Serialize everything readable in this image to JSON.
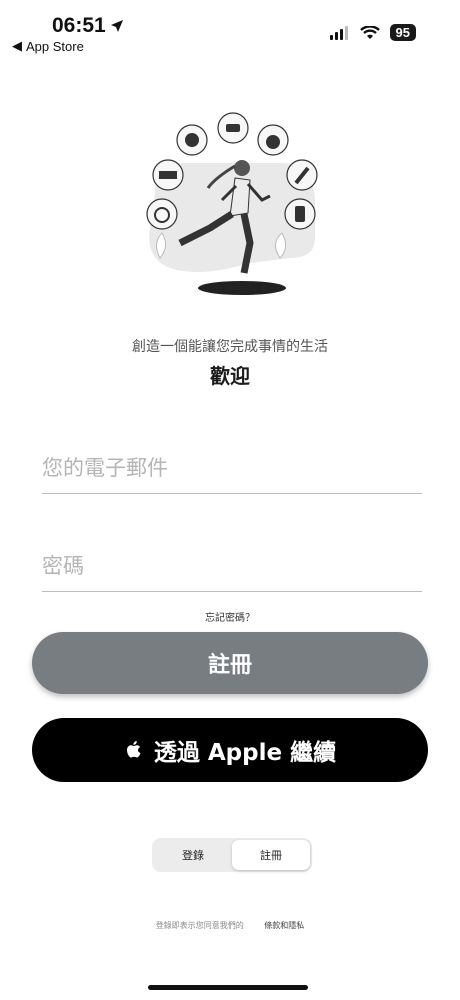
{
  "status_bar": {
    "time": "06:51",
    "back_label": "App Store",
    "battery": "95"
  },
  "intro": {
    "tagline": "創造一個能讓您完成事情的生活",
    "welcome": "歡迎"
  },
  "form": {
    "email_placeholder": "您的電子郵件",
    "password_placeholder": "密碼",
    "forgot_password": "忘記密碼？"
  },
  "buttons": {
    "register": "註冊",
    "apple_continue": "透過 Apple 繼續"
  },
  "segmented": {
    "login": "登錄",
    "register": "註冊",
    "selected": "註冊"
  },
  "footer": {
    "terms_prefix": "登錄即表示您同意我們的",
    "terms_link": "條款和隱私"
  }
}
